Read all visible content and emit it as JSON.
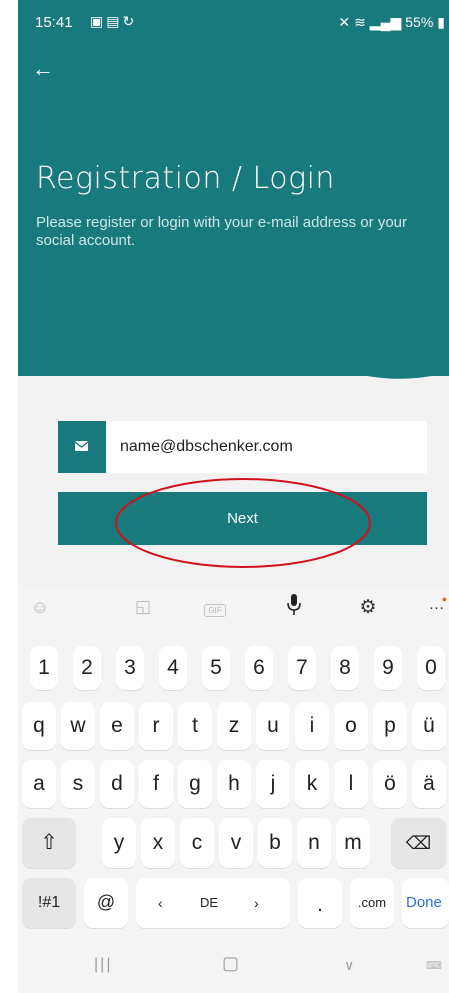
{
  "status_bar": {
    "time": "15:41",
    "left_icons": [
      "image-icon",
      "message-icon",
      "sync-icon"
    ],
    "right_icons": [
      "mute-icon",
      "wifi-icon",
      "signal-icon",
      "signal-icon"
    ],
    "battery": "55%"
  },
  "header": {
    "title": "Registration / Login",
    "subtitle": "Please register or login with your e-mail address or your social account."
  },
  "form": {
    "email_value": "name@dbschenker.com",
    "next_label": "Next"
  },
  "keyboard": {
    "toolbar": [
      "emoji-icon",
      "sticker-icon",
      "gif-icon",
      "mic-icon",
      "settings-icon",
      "more-icon"
    ],
    "gif_label": "GIF",
    "row1": [
      "1",
      "2",
      "3",
      "4",
      "5",
      "6",
      "7",
      "8",
      "9",
      "0"
    ],
    "row2": [
      "q",
      "w",
      "e",
      "r",
      "t",
      "z",
      "u",
      "i",
      "o",
      "p",
      "ü"
    ],
    "row3": [
      "a",
      "s",
      "d",
      "f",
      "g",
      "h",
      "j",
      "k",
      "l",
      "ö",
      "ä"
    ],
    "row4": [
      "y",
      "x",
      "c",
      "v",
      "b",
      "n",
      "m"
    ],
    "symbols_label": "!#1",
    "at_label": "@",
    "space_left": "‹",
    "space_lang": "DE",
    "space_right": "›",
    "dot_label": ".",
    "com_label": ".com",
    "done_label": "Done"
  },
  "colors": {
    "brand_teal": "#187a7c",
    "annotation_red": "#d0121b",
    "done_blue": "#2f6fd6"
  }
}
